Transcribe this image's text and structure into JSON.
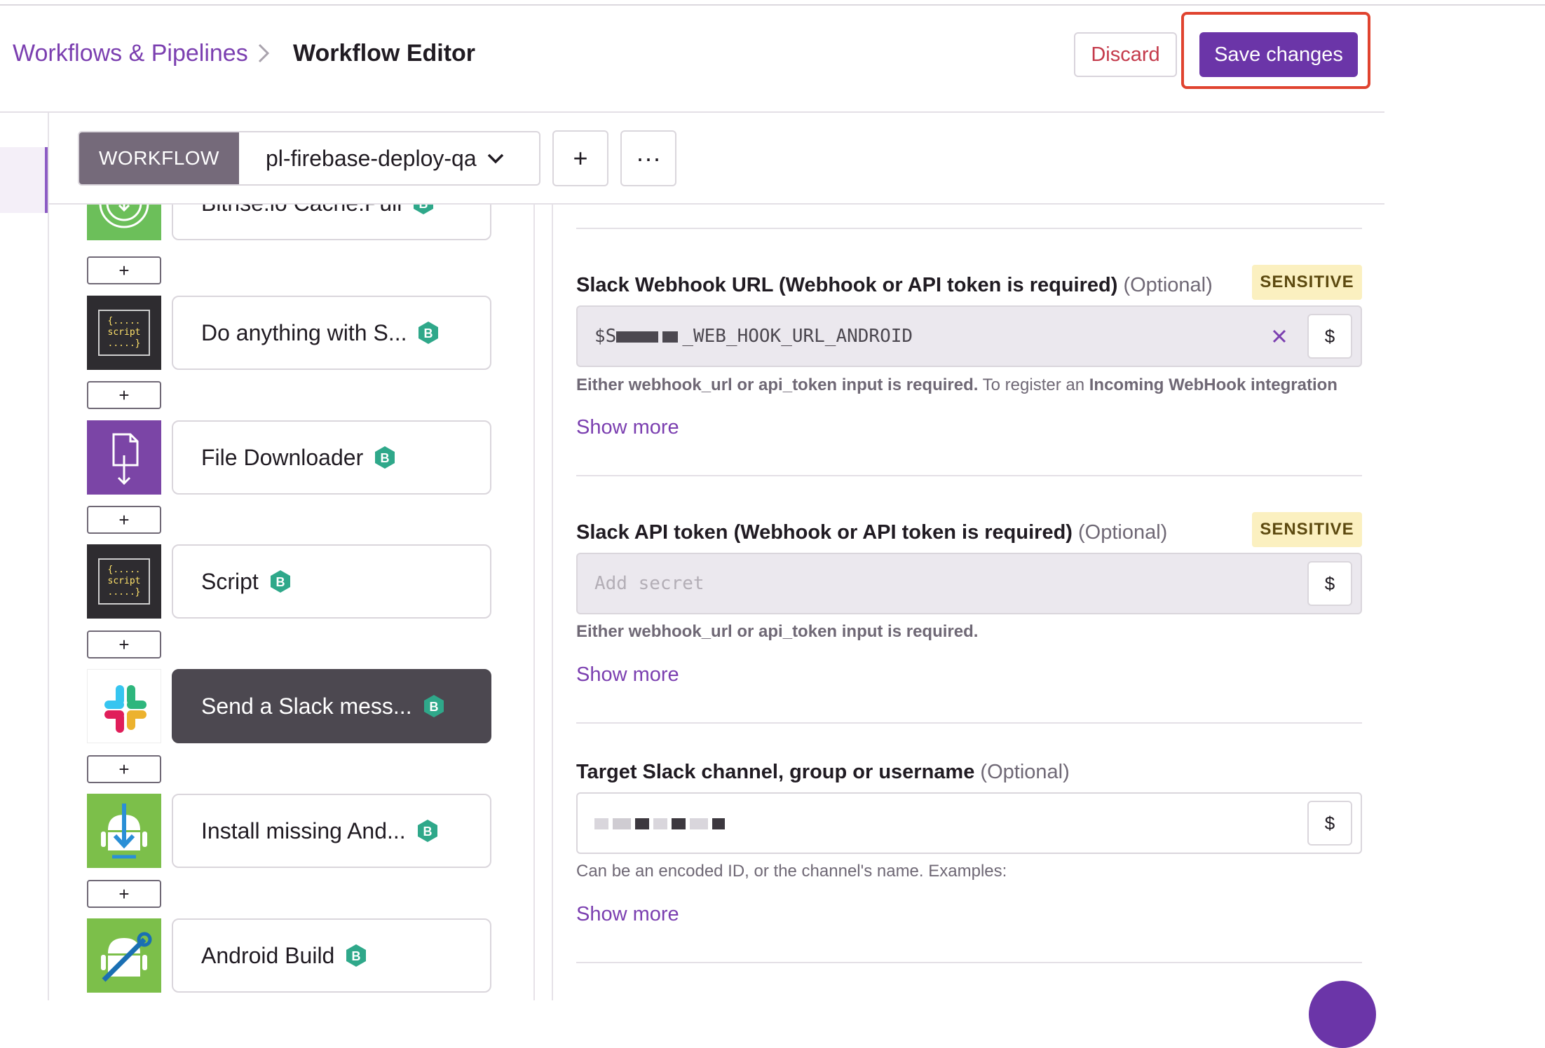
{
  "breadcrumb": {
    "parent": "Workflows & Pipelines",
    "current": "Workflow Editor"
  },
  "header_actions": {
    "discard": "Discard",
    "save": "Save changes"
  },
  "workflow_bar": {
    "label": "WORKFLOW",
    "selected_workflow": "pl-firebase-deploy-qa",
    "add_symbol": "+",
    "more_symbol": "···"
  },
  "steps": [
    {
      "title": "Bitrise.io Cache:Pull",
      "icon": "cache-pull-icon",
      "badge": "B"
    },
    {
      "title": "Do anything with S...",
      "icon": "script-icon",
      "badge": "B"
    },
    {
      "title": "File Downloader",
      "icon": "file-download-icon",
      "badge": "B"
    },
    {
      "title": "Script",
      "icon": "script-icon",
      "badge": "B"
    },
    {
      "title": "Send a Slack mess...",
      "icon": "slack-icon",
      "badge": "B",
      "selected": true
    },
    {
      "title": "Install missing And...",
      "icon": "android-install-icon",
      "badge": "B"
    },
    {
      "title": "Android Build",
      "icon": "android-build-icon",
      "badge": "B"
    }
  ],
  "script_icon_text": [
    "{.....",
    "script",
    ".....}"
  ],
  "add_step_symbol": "+",
  "inputs": {
    "webhook": {
      "label": "Slack Webhook URL (Webhook or API token is required)",
      "optional": "(Optional)",
      "sensitive": "SENSITIVE",
      "value_prefix": "$S",
      "value_suffix": "_WEB_HOOK_URL_ANDROID",
      "help_bold_1": "Either webhook_url or api_token input is required.",
      "help_text": " To register an ",
      "help_bold_2": "Incoming WebHook integration",
      "show_more": "Show more",
      "var_symbol": "$"
    },
    "api_token": {
      "label": "Slack API token (Webhook or API token is required)",
      "optional": "(Optional)",
      "sensitive": "SENSITIVE",
      "placeholder": "Add secret",
      "help_bold": "Either webhook_url or api_token input is required.",
      "show_more": "Show more",
      "var_symbol": "$"
    },
    "channel": {
      "label": "Target Slack channel, group or username",
      "optional": "(Optional)",
      "help": "Can be an encoded ID, or the channel's name. Examples:",
      "show_more": "Show more",
      "var_symbol": "$"
    }
  },
  "colors": {
    "primary": "#6b35a8",
    "link": "#7b3fb0",
    "danger": "#c43a4b",
    "highlight": "#e0432f",
    "sensitive_bg": "#fbf0c0",
    "selected_step": "#4c4850"
  }
}
